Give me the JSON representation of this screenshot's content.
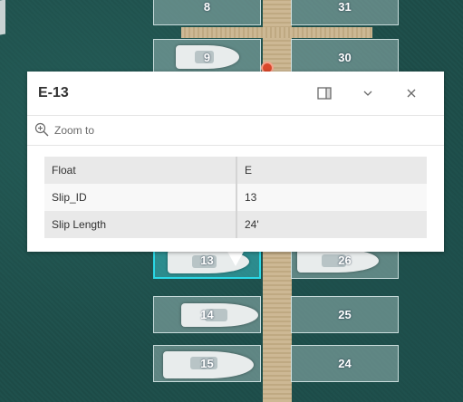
{
  "map": {
    "slips_left": [
      "8",
      "9",
      "13",
      "14",
      "15"
    ],
    "slips_right": [
      "31",
      "30",
      "26",
      "25",
      "24"
    ],
    "selected_slip": "13"
  },
  "popup": {
    "title": "E-13",
    "dock_icon": "dock-panel-icon",
    "collapse_icon": "chevron-down-icon",
    "close_icon": "close-icon",
    "zoom_icon": "zoom-in-icon",
    "zoom_label": "Zoom to",
    "fields": [
      {
        "label": "Float",
        "value": "E"
      },
      {
        "label": "Slip_ID",
        "value": "13"
      },
      {
        "label": "Slip Length",
        "value": "24'"
      }
    ]
  },
  "colors": {
    "water": "#1f4e4a",
    "selected_outline": "#2ad8e6",
    "marker": "#d9472b"
  }
}
